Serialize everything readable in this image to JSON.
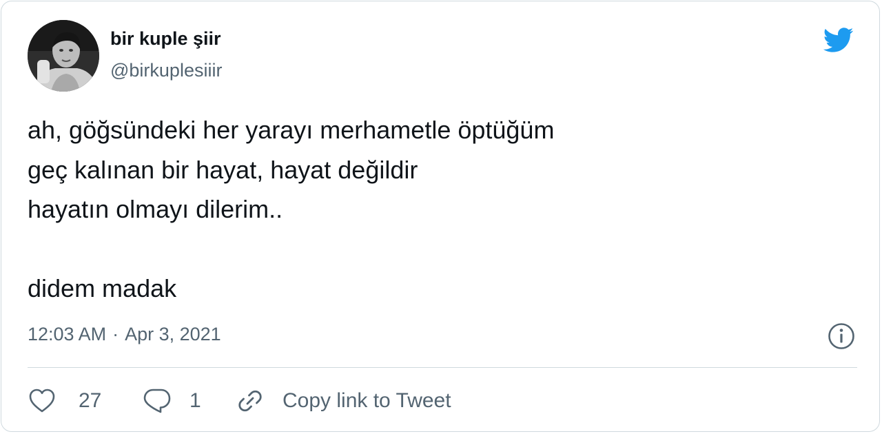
{
  "author": {
    "display_name": "bir kuple şiir",
    "handle": "@birkuplesiiir"
  },
  "tweet": {
    "lines": [
      "ah, göğsündeki her yarayı merhametle öptüğüm",
      "geç kalınan bir hayat, hayat değildir",
      "hayatın olmayı dilerim..",
      "",
      "didem madak"
    ],
    "time": "12:03 AM",
    "separator": "·",
    "date": "Apr 3, 2021"
  },
  "actions": {
    "likes": "27",
    "replies": "1",
    "copy_link_label": "Copy link to Tweet"
  },
  "icons": {
    "brand": "twitter-bird-icon",
    "info": "info-icon",
    "like": "heart-icon",
    "reply": "reply-bubble-icon",
    "copy": "link-icon"
  },
  "colors": {
    "twitter_blue": "#1d9bf0",
    "text_primary": "#0f1419",
    "text_secondary": "#536471",
    "border": "#cfd9de"
  }
}
